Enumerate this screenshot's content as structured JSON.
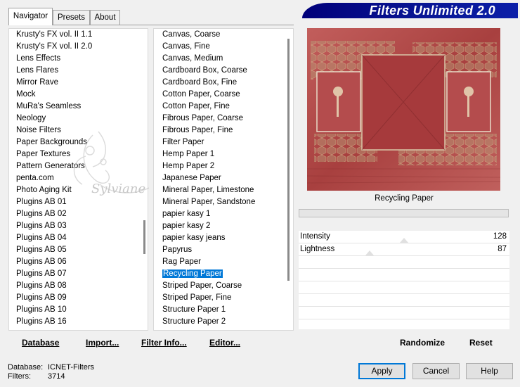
{
  "app": {
    "title": "Filters Unlimited 2.0"
  },
  "tabs": [
    "Navigator",
    "Presets",
    "About"
  ],
  "categories": [
    "Krusty's FX vol. II 1.1",
    "Krusty's FX vol. II 2.0",
    "Lens Effects",
    "Lens Flares",
    "Mirror Rave",
    "Mock",
    "MuRa's Seamless",
    "Neology",
    "Noise Filters",
    "Paper Backgrounds",
    "Paper Textures",
    "Pattern Generators",
    "penta.com",
    "Photo Aging Kit",
    "Plugins AB 01",
    "Plugins AB 02",
    "Plugins AB 03",
    "Plugins AB 04",
    "Plugins AB 05",
    "Plugins AB 06",
    "Plugins AB 07",
    "Plugins AB 08",
    "Plugins AB 09",
    "Plugins AB 10",
    "Plugins AB 16"
  ],
  "filters": [
    "Canvas, Coarse",
    "Canvas, Fine",
    "Canvas, Medium",
    "Cardboard Box, Coarse",
    "Cardboard Box, Fine",
    "Cotton Paper, Coarse",
    "Cotton Paper, Fine",
    "Fibrous Paper, Coarse",
    "Fibrous Paper, Fine",
    "Filter Paper",
    "Hemp Paper 1",
    "Hemp Paper 2",
    "Japanese Paper",
    "Mineral Paper, Limestone",
    "Mineral Paper, Sandstone",
    "papier kasy 1",
    "papier kasy 2",
    "papier kasy jeans",
    "Papyrus",
    "Rag Paper",
    "Recycling Paper",
    "Striped Paper, Coarse",
    "Striped Paper, Fine",
    "Structure Paper 1",
    "Structure Paper 2"
  ],
  "selected_filter": "Recycling Paper",
  "watermark": "Sylviane",
  "preview": {
    "filter_name": "Recycling Paper"
  },
  "controls": [
    {
      "label": "Intensity",
      "value": "128"
    },
    {
      "label": "Lightness",
      "value": "87"
    }
  ],
  "toolbar": {
    "database": "Database",
    "import": "Import...",
    "filter_info": "Filter Info...",
    "editor": "Editor...",
    "randomize": "Randomize",
    "reset": "Reset"
  },
  "status": {
    "database_label": "Database:",
    "database_value": "ICNET-Filters",
    "filters_label": "Filters:",
    "filters_value": "3714"
  },
  "buttons": {
    "apply": "Apply",
    "cancel": "Cancel",
    "help": "Help"
  },
  "colors": {
    "accent": "#0078d7",
    "banner": "#0a1796",
    "preview_base": "#b24e4f"
  }
}
